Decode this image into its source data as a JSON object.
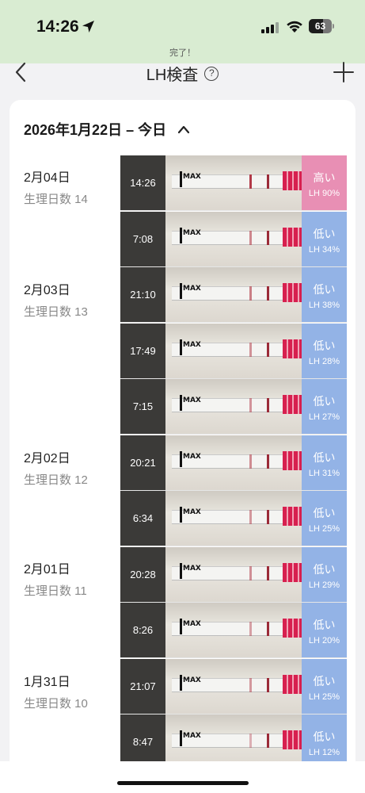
{
  "status_bar": {
    "time": "14:26",
    "battery": "63",
    "toast": "完了！"
  },
  "nav": {
    "title": "LH検査",
    "help_glyph": "?"
  },
  "range": {
    "label": "2026年1月22日 – 今日"
  },
  "days": [
    {
      "date": "2月04日",
      "cycle": "生理日数 14"
    },
    {
      "date": "2月03日",
      "cycle": "生理日数 13"
    },
    {
      "date": "2月02日",
      "cycle": "生理日数 12"
    },
    {
      "date": "2月01日",
      "cycle": "生理日数 11"
    },
    {
      "date": "1月31日",
      "cycle": "生理日数 10"
    }
  ],
  "tests": [
    {
      "time": "14:26",
      "level": "高い",
      "lh": "LH 90%",
      "lh_value": 90
    },
    {
      "time": "7:08",
      "level": "低い",
      "lh": "LH 34%",
      "lh_value": 34
    },
    {
      "time": "21:10",
      "level": "低い",
      "lh": "LH 38%",
      "lh_value": 38
    },
    {
      "time": "17:49",
      "level": "低い",
      "lh": "LH 28%",
      "lh_value": 28
    },
    {
      "time": "7:15",
      "level": "低い",
      "lh": "LH 27%",
      "lh_value": 27
    },
    {
      "time": "20:21",
      "level": "低い",
      "lh": "LH 31%",
      "lh_value": 31
    },
    {
      "time": "6:34",
      "level": "低い",
      "lh": "LH 25%",
      "lh_value": 25
    },
    {
      "time": "20:28",
      "level": "低い",
      "lh": "LH 29%",
      "lh_value": 29
    },
    {
      "time": "8:26",
      "level": "低い",
      "lh": "LH 20%",
      "lh_value": 20
    },
    {
      "time": "21:07",
      "level": "低い",
      "lh": "LH 25%",
      "lh_value": 25
    },
    {
      "time": "8:47",
      "level": "低い",
      "lh": "LH 12%",
      "lh_value": 12
    }
  ],
  "strip_text": "MAX",
  "colors": {
    "status_bar_bg": "#d9ecd2",
    "high_result": "#e88fb4",
    "low_result": "#93b3e6",
    "time_cell": "#3b3a38"
  }
}
